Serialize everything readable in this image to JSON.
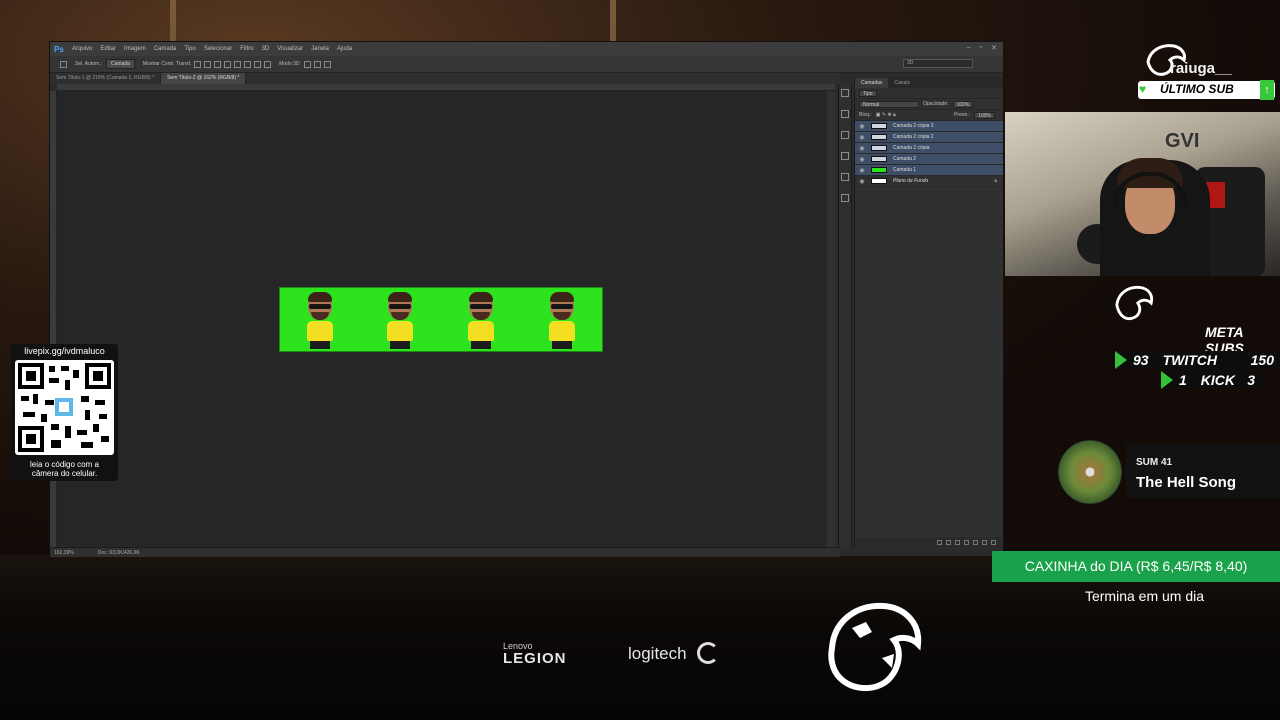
{
  "photoshop": {
    "logo": "Ps",
    "menu": [
      "Arquivo",
      "Editar",
      "Imagem",
      "Camada",
      "Tipo",
      "Selecionar",
      "Filtro",
      "3D",
      "Visualizar",
      "Janela",
      "Ajuda"
    ],
    "options": {
      "auto_select": "Sel. Autom.:",
      "layer_field": "Camada",
      "show_transform": "Mostrar Contr. Transf.",
      "mode_3d": "Modo 3D:",
      "workspace": "3D"
    },
    "doc_tabs": [
      "Sem Título-1 @ 218% (Camada 2, RGB/8) *",
      "Sem Título-2 @ 162% (RGB/8) *"
    ],
    "status": {
      "zoom": "162,39%",
      "doc": "Doc: 93,0K/426,9K"
    },
    "layers_panel": {
      "tabs": [
        "Camadas",
        "Canais"
      ],
      "kind": "Tipo",
      "blend": "Normal",
      "opacity_label": "Opacidade:",
      "opacity_value": "100%",
      "lock_label": "Bloq.:",
      "fill_label": "Preen.:",
      "fill_value": "100%",
      "layers": [
        {
          "name": "Camada 2 cópia 3",
          "selected": true,
          "thumb": "#cfd6e0"
        },
        {
          "name": "Camada 2 cópia 2",
          "selected": true,
          "thumb": "#cfd6e0"
        },
        {
          "name": "Camada 2 cópia",
          "selected": true,
          "thumb": "#cfd6e0"
        },
        {
          "name": "Camada 2",
          "selected": true,
          "thumb": "#cfd6e0"
        },
        {
          "name": "Camada 1",
          "selected": true,
          "thumb": "#2de31d"
        },
        {
          "name": "Plano de Fundo",
          "selected": false,
          "thumb": "#ffffff"
        }
      ]
    }
  },
  "qr": {
    "url": "livepix.gg/ivdmaluco",
    "caption_1": "leia o código com a",
    "caption_2": "câmera do celular."
  },
  "last_sub": {
    "name": "raiuga__",
    "label": "ÚLTIMO SUB"
  },
  "sub_goal": {
    "title": "META SUBS",
    "rows": [
      {
        "count": "93",
        "platform": "TWITCH",
        "goal": "150"
      },
      {
        "count": "1",
        "platform": "KICK",
        "goal": "3"
      }
    ]
  },
  "music": {
    "artist": "SUM 41",
    "song": "The Hell Song"
  },
  "caixinha": {
    "text": "CAXINHA do DIA (R$ 6,45/R$ 8,40)",
    "sub": "Termina em um dia"
  },
  "sponsors": {
    "lenovo": "Lenovo",
    "legion": "LEGION",
    "logitech": "logitech"
  },
  "colors": {
    "green_screen": "#2de31d",
    "accent_green": "#35c139",
    "selection_blue": "#3d4e66"
  }
}
